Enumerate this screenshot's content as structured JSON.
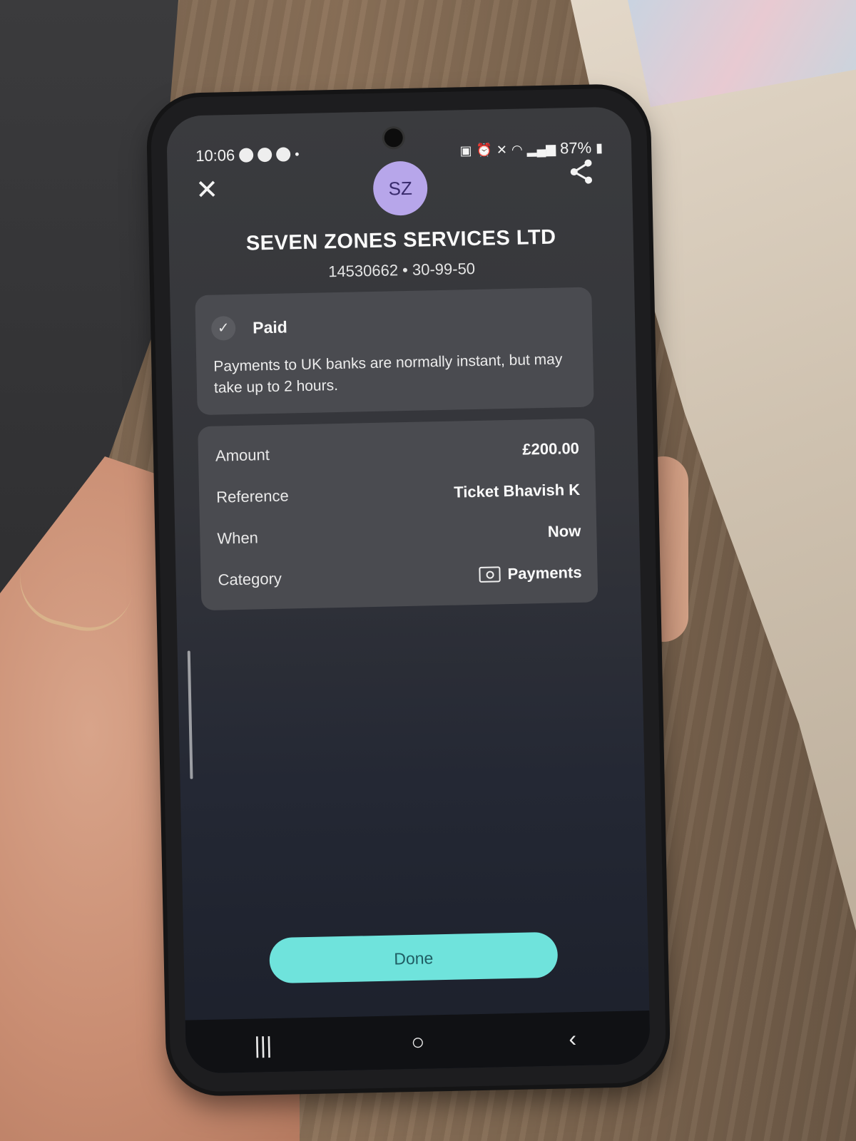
{
  "status_bar": {
    "time": "10:06",
    "battery": "87%"
  },
  "header": {
    "avatar_initials": "SZ",
    "payee_name": "SEVEN ZONES SERVICES LTD",
    "account_details": "14530662 • 30-99-50"
  },
  "status_card": {
    "title": "Paid",
    "description": "Payments to UK banks are normally instant, but may take up to 2 hours."
  },
  "details": [
    {
      "label": "Amount",
      "value": "£200.00"
    },
    {
      "label": "Reference",
      "value": "Ticket Bhavish K"
    },
    {
      "label": "When",
      "value": "Now"
    },
    {
      "label": "Category",
      "value": "Payments",
      "icon": "camera-icon"
    }
  ],
  "actions": {
    "done_label": "Done"
  },
  "nav": {
    "recents_glyph": "|||",
    "home_glyph": "○",
    "back_glyph": "‹"
  },
  "colors": {
    "accent_button": "#6fe3dc",
    "avatar_bg": "#b7a6ea",
    "card_bg": "#4a4b50"
  }
}
